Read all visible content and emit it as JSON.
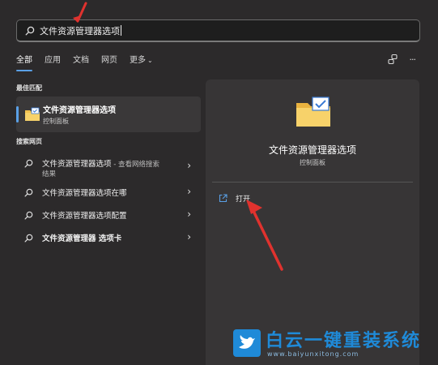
{
  "search": {
    "query": "文件资源管理器选项"
  },
  "tabs": [
    {
      "label": "全部",
      "active": true
    },
    {
      "label": "应用"
    },
    {
      "label": "文档"
    },
    {
      "label": "网页"
    },
    {
      "label": "更多",
      "chevron": "⌄"
    }
  ],
  "toolbar": {
    "share_icon": "connect-icon",
    "more_label": "···"
  },
  "best_match": {
    "section_label": "最佳匹配",
    "title": "文件资源管理器选项",
    "subtitle": "控制面板"
  },
  "web_search": {
    "section_label": "搜索网页",
    "items": [
      {
        "text": "文件资源管理器选项",
        "extra": " - 查看网络搜索",
        "line2": "结果"
      },
      {
        "text": "文件资源管理器选项在哪"
      },
      {
        "text": "文件资源管理器选项配置"
      },
      {
        "text": "文件资源管理器 选项卡"
      }
    ]
  },
  "detail": {
    "title": "文件资源管理器选项",
    "subtitle": "控制面板",
    "actions": [
      {
        "label": "打开"
      }
    ]
  },
  "watermark": {
    "title": "白云一键重装系统",
    "url": "www.baiyunxitong.com"
  },
  "colors": {
    "accent": "#5aa0e6",
    "annotation": "#e0322e",
    "folder": "#f2c14e"
  }
}
